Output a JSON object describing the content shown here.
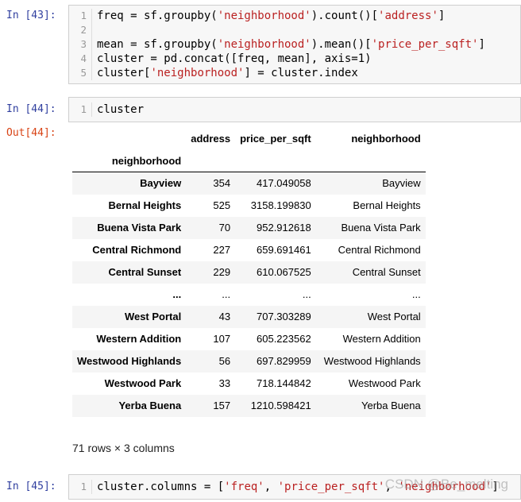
{
  "cells": {
    "c43": {
      "prompt": "In  [43]:",
      "lines": [
        {
          "n": "1",
          "parts": [
            [
              "freq = sf.groupby(",
              ""
            ],
            [
              "'neighborhood'",
              "str"
            ],
            [
              ").count()[",
              ""
            ],
            [
              "'address'",
              "str"
            ],
            [
              "]",
              ""
            ]
          ]
        },
        {
          "n": "2",
          "parts": [
            [
              "",
              ""
            ]
          ]
        },
        {
          "n": "3",
          "parts": [
            [
              "mean = sf.groupby(",
              ""
            ],
            [
              "'neighborhood'",
              "str"
            ],
            [
              ").mean()[",
              ""
            ],
            [
              "'price_per_sqft'",
              "str"
            ],
            [
              "]",
              ""
            ]
          ]
        },
        {
          "n": "4",
          "parts": [
            [
              "cluster = pd.concat([freq, mean], axis=1)",
              ""
            ]
          ]
        },
        {
          "n": "5",
          "parts": [
            [
              "cluster[",
              ""
            ],
            [
              "'neighborhood'",
              "str"
            ],
            [
              "] = cluster.index",
              ""
            ]
          ]
        }
      ]
    },
    "c44": {
      "prompt": "In  [44]:",
      "out_prompt": "Out[44]:",
      "code": "cluster"
    },
    "c45": {
      "prompt": "In  [45]:",
      "parts": [
        [
          "cluster.columns = [",
          ""
        ],
        [
          "'freq'",
          "str"
        ],
        [
          ", ",
          ""
        ],
        [
          "'price_per_sqft'",
          "str"
        ],
        [
          ", ",
          ""
        ],
        [
          "'neighborhood'",
          "str"
        ],
        [
          "]",
          ""
        ]
      ]
    }
  },
  "dataframe": {
    "columns": [
      "address",
      "price_per_sqft",
      "neighborhood"
    ],
    "index_name": "neighborhood",
    "rows": [
      [
        "Bayview",
        "354",
        "417.049058",
        "Bayview"
      ],
      [
        "Bernal Heights",
        "525",
        "3158.199830",
        "Bernal Heights"
      ],
      [
        "Buena Vista Park",
        "70",
        "952.912618",
        "Buena Vista Park"
      ],
      [
        "Central Richmond",
        "227",
        "659.691461",
        "Central Richmond"
      ],
      [
        "Central Sunset",
        "229",
        "610.067525",
        "Central Sunset"
      ],
      [
        "...",
        "...",
        "...",
        "..."
      ],
      [
        "West Portal",
        "43",
        "707.303289",
        "West Portal"
      ],
      [
        "Western Addition",
        "107",
        "605.223562",
        "Western Addition"
      ],
      [
        "Westwood Highlands",
        "56",
        "697.829959",
        "Westwood Highlands"
      ],
      [
        "Westwood Park",
        "33",
        "718.144842",
        "Westwood Park"
      ],
      [
        "Yerba Buena",
        "157",
        "1210.598421",
        "Yerba Buena"
      ]
    ],
    "shape": "71 rows × 3 columns"
  },
  "watermark": "CSDN @Be_melting"
}
